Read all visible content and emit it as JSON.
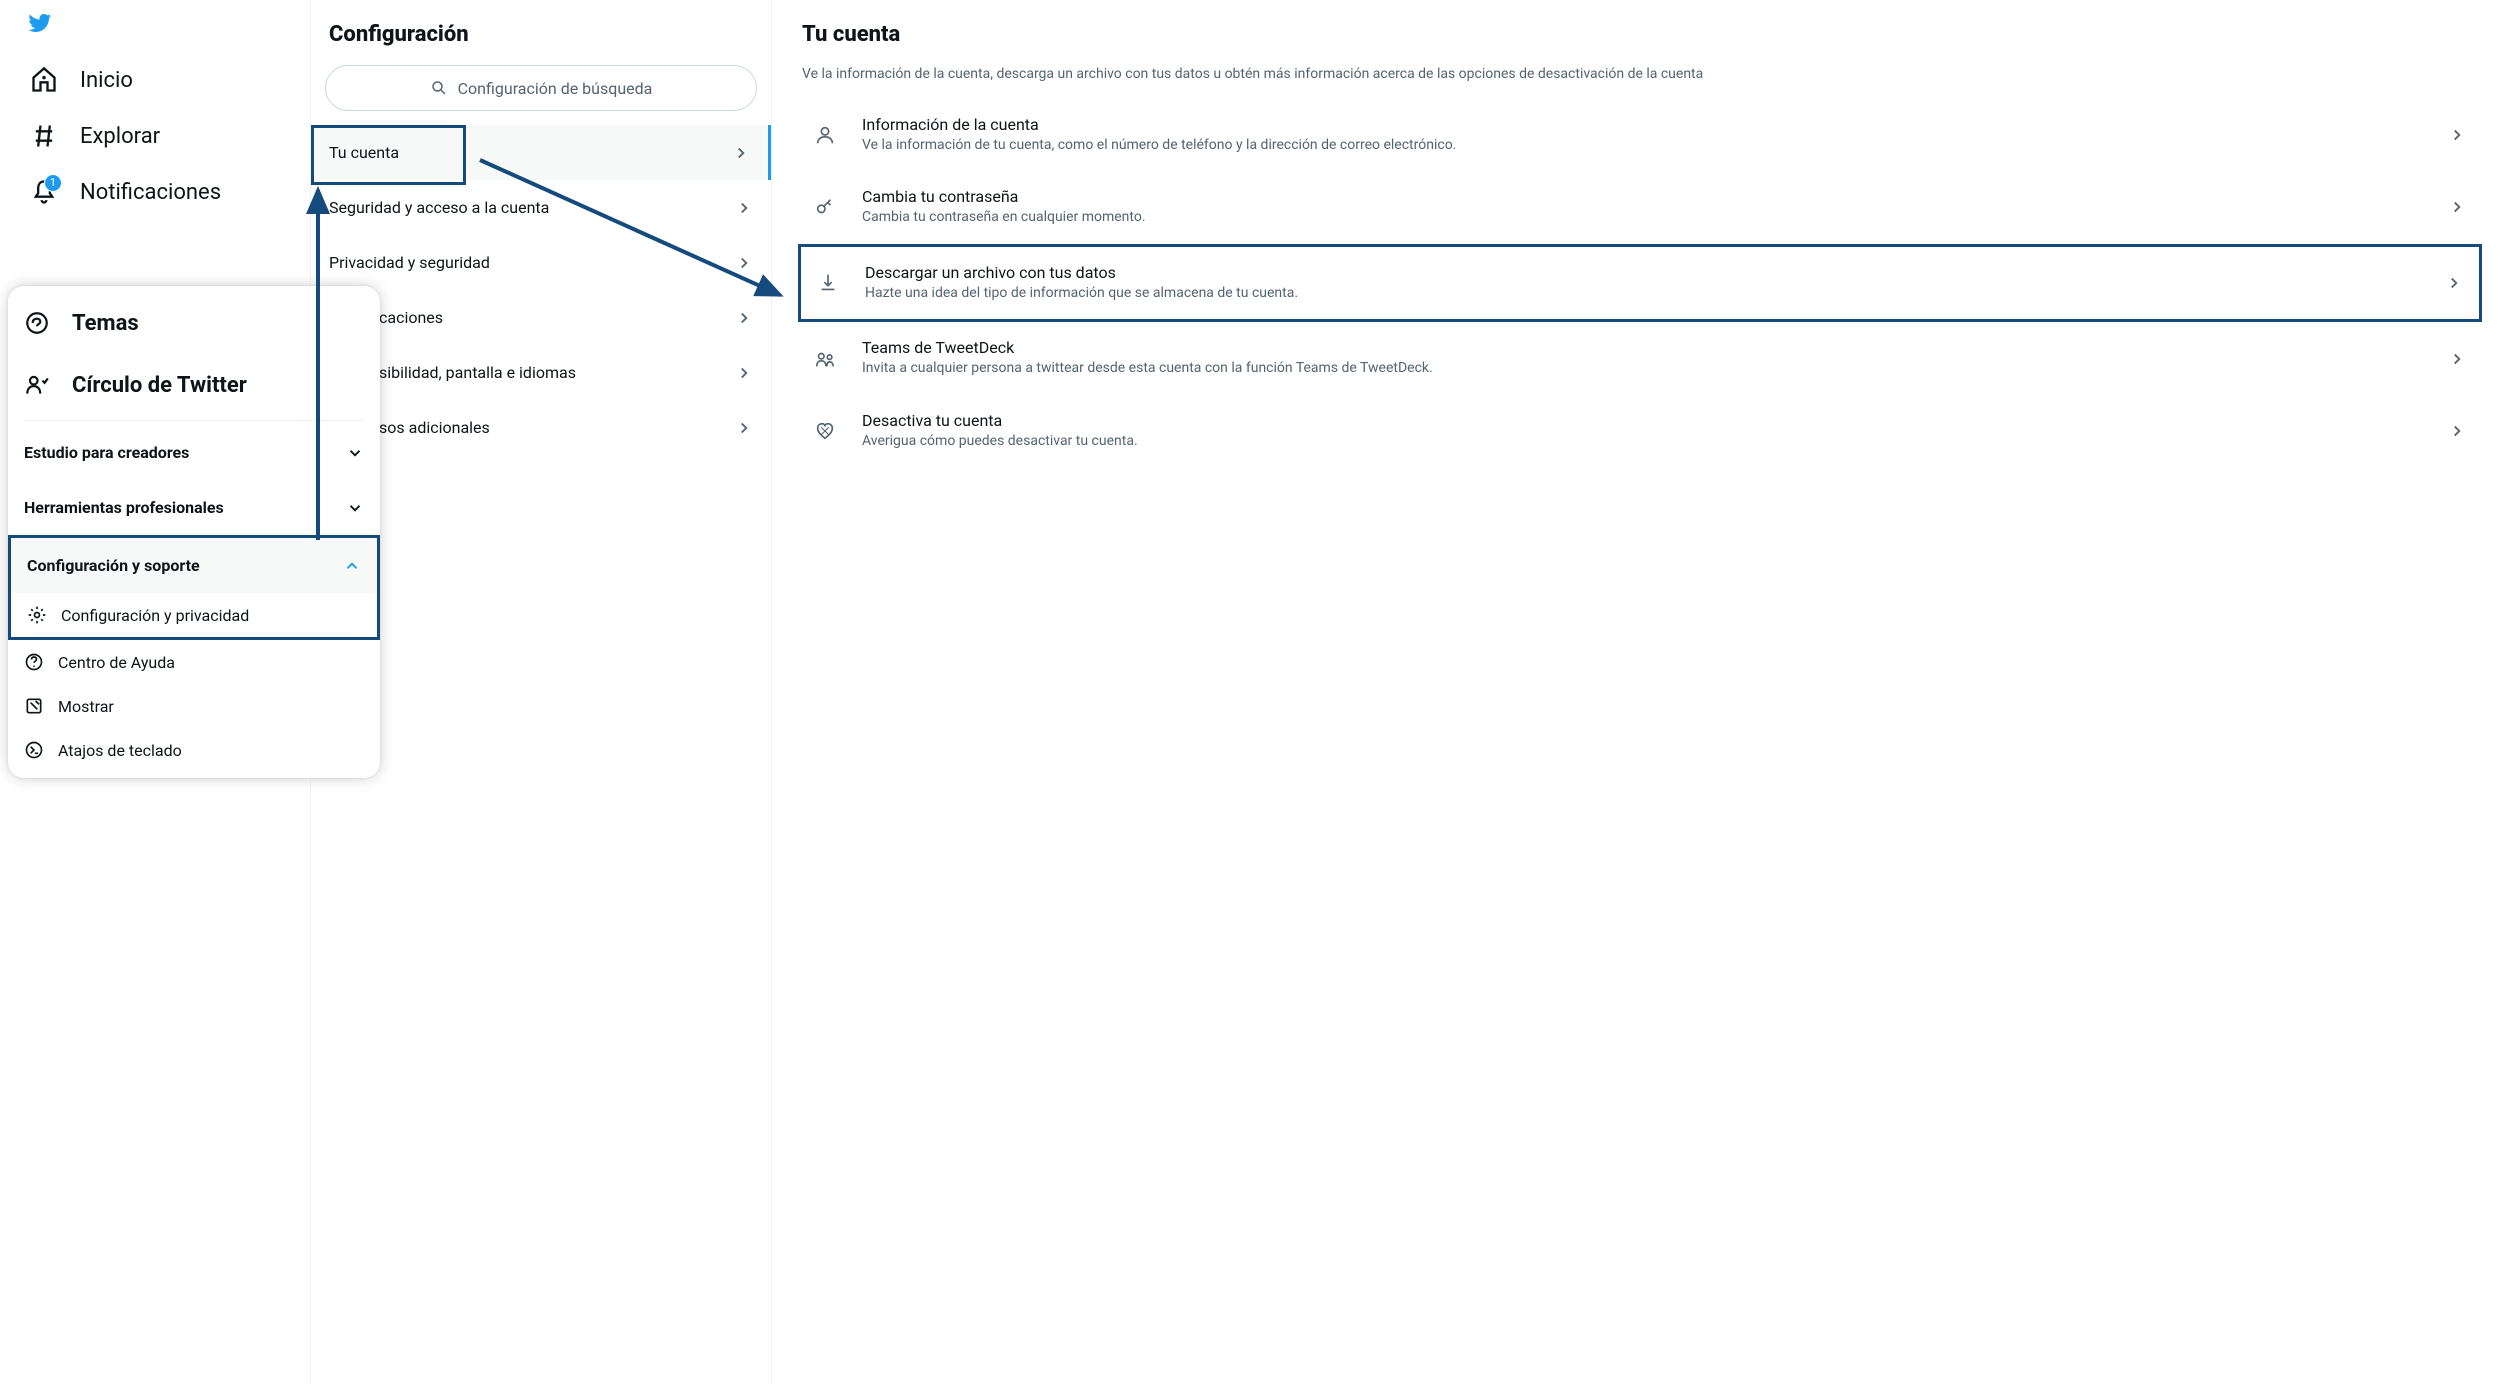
{
  "nav": {
    "home": "Inicio",
    "explore": "Explorar",
    "notifications": "Notificaciones",
    "notifications_badge": "1"
  },
  "popup": {
    "topics": "Temas",
    "circle": "Círculo de Twitter",
    "creator_studio": "Estudio para creadores",
    "pro_tools": "Herramientas profesionales",
    "settings_support": "Configuración y soporte",
    "settings_privacy": "Configuración y privacidad",
    "help_center": "Centro de Ayuda",
    "display": "Mostrar",
    "keyboard_shortcuts": "Atajos de teclado"
  },
  "middle": {
    "title": "Configuración",
    "search_placeholder": "Configuración de búsqueda",
    "items": [
      "Tu cuenta",
      "Seguridad y acceso a la cuenta",
      "Privacidad y seguridad",
      "Notificaciones",
      "Accesibilidad, pantalla e idiomas",
      "Recursos adicionales"
    ],
    "items_partial": {
      "3": "caciones",
      "4": "sibilidad, pantalla e idiomas",
      "5": "sos adicionales"
    }
  },
  "right": {
    "title": "Tu cuenta",
    "subtitle": "Ve la información de la cuenta, descarga un archivo con tus datos u obtén más información acerca de las opciones de desactivación de la cuenta",
    "options": [
      {
        "title": "Información de la cuenta",
        "desc": "Ve la información de tu cuenta, como el número de teléfono y la dirección de correo electrónico."
      },
      {
        "title": "Cambia tu contraseña",
        "desc": "Cambia tu contraseña en cualquier momento."
      },
      {
        "title": "Descargar un archivo con tus datos",
        "desc": "Hazte una idea del tipo de información que se almacena de tu cuenta."
      },
      {
        "title": "Teams de TweetDeck",
        "desc": "Invita a cualquier persona a twittear desde esta cuenta con la función Teams de TweetDeck."
      },
      {
        "title": "Desactiva tu cuenta",
        "desc": "Averigua cómo puedes desactivar tu cuenta."
      }
    ]
  },
  "annotation": {
    "highlight_color": "#144a7c"
  }
}
